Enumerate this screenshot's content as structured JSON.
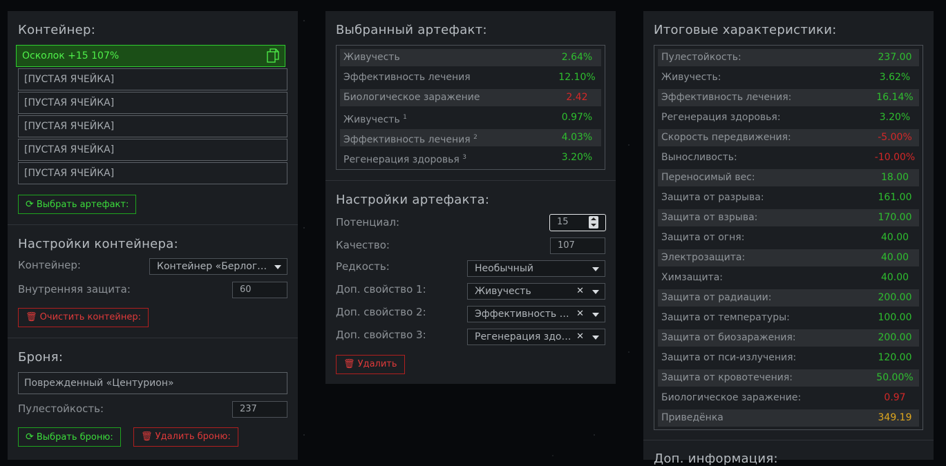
{
  "container_panel": {
    "title": "Контейнер:",
    "slots": [
      {
        "label": "Осколок +15 107%",
        "active": true
      },
      {
        "label": "[ПУСТАЯ ЯЧЕЙКА]"
      },
      {
        "label": "[ПУСТАЯ ЯЧЕЙКА]"
      },
      {
        "label": "[ПУСТАЯ ЯЧЕЙКА]"
      },
      {
        "label": "[ПУСТАЯ ЯЧЕЙКА]"
      },
      {
        "label": "[ПУСТАЯ ЯЧЕЙКА]"
      }
    ],
    "choose_artifact_label": "Выбрать артефакт:",
    "settings_title": "Настройки контейнера:",
    "container_label": "Контейнер:",
    "container_value": "Контейнер «Берлога…",
    "inner_protection_label": "Внутренняя защита:",
    "inner_protection_value": "60",
    "clear_label": "Очистить контейнер:",
    "armor_title": "Броня:",
    "armor_value": "Поврежденный «Центурион»",
    "bullet_label": "Пулестойкость:",
    "bullet_value": "237",
    "choose_armor_label": "Выбрать броню:",
    "delete_armor_label": "Удалить броню:"
  },
  "artifact_panel": {
    "title": "Выбранный артефакт:",
    "stats": [
      {
        "name": "Живучесть",
        "sup": "",
        "value": "2.64%",
        "color": "g"
      },
      {
        "name": "Эффективность лечения",
        "sup": "",
        "value": "12.10%",
        "color": "g"
      },
      {
        "name": "Биологическое заражение",
        "sup": "",
        "value": "2.42",
        "color": "r"
      },
      {
        "name": "Живучесть",
        "sup": "1",
        "value": "0.97%",
        "color": "g"
      },
      {
        "name": "Эффективность лечения",
        "sup": "2",
        "value": "4.03%",
        "color": "g"
      },
      {
        "name": "Регенерация здоровья",
        "sup": "3",
        "value": "3.20%",
        "color": "g"
      }
    ],
    "settings_title": "Настройки артефакта:",
    "potential_label": "Потенциал:",
    "potential_value": "15",
    "quality_label": "Качество:",
    "quality_value": "107",
    "rarity_label": "Редкость:",
    "rarity_value": "Необычный",
    "prop1_label": "Доп. свойство 1:",
    "prop1_value": "Живучесть",
    "prop2_label": "Доп. свойство 2:",
    "prop2_value": "Эффективность лечения",
    "prop3_label": "Доп. свойство 3:",
    "prop3_value": "Регенерация здоровья",
    "delete_label": "Удалить"
  },
  "totals_panel": {
    "title": "Итоговые характеристики:",
    "stats": [
      {
        "name": "Пулестойкость:",
        "value": "237.00",
        "color": "g"
      },
      {
        "name": "Живучесть:",
        "value": "3.62%",
        "color": "g"
      },
      {
        "name": "Эффективность лечения:",
        "value": "16.14%",
        "color": "g"
      },
      {
        "name": "Регенерация здоровья:",
        "value": "3.20%",
        "color": "g"
      },
      {
        "name": "Скорость передвижения:",
        "value": "-5.00%",
        "color": "r"
      },
      {
        "name": "Выносливость:",
        "value": "-10.00%",
        "color": "r"
      },
      {
        "name": "Переносимый вес:",
        "value": "18.00",
        "color": "g"
      },
      {
        "name": "Защита от разрыва:",
        "value": "161.00",
        "color": "g"
      },
      {
        "name": "Защита от взрыва:",
        "value": "170.00",
        "color": "g"
      },
      {
        "name": "Защита от огня:",
        "value": "40.00",
        "color": "g"
      },
      {
        "name": "Электрозащита:",
        "value": "40.00",
        "color": "g"
      },
      {
        "name": "Химзащита:",
        "value": "40.00",
        "color": "g"
      },
      {
        "name": "Защита от радиации:",
        "value": "200.00",
        "color": "g"
      },
      {
        "name": "Защита от температуры:",
        "value": "100.00",
        "color": "g"
      },
      {
        "name": "Защита от биозаражения:",
        "value": "200.00",
        "color": "g"
      },
      {
        "name": "Защита от пси-излучения:",
        "value": "120.00",
        "color": "g"
      },
      {
        "name": "Защита от кровотечения:",
        "value": "50.00%",
        "color": "g"
      },
      {
        "name": "Биологическое заражение:",
        "value": "0.97",
        "color": "r"
      },
      {
        "name": "Приведёнка",
        "value": "349.19",
        "color": "y"
      }
    ],
    "extra_title": "Доп. информация:"
  },
  "colors": {
    "green": "#2fbf2f",
    "red": "#d42828",
    "yellow": "#e0a81e",
    "panel": "#1b1e22"
  }
}
